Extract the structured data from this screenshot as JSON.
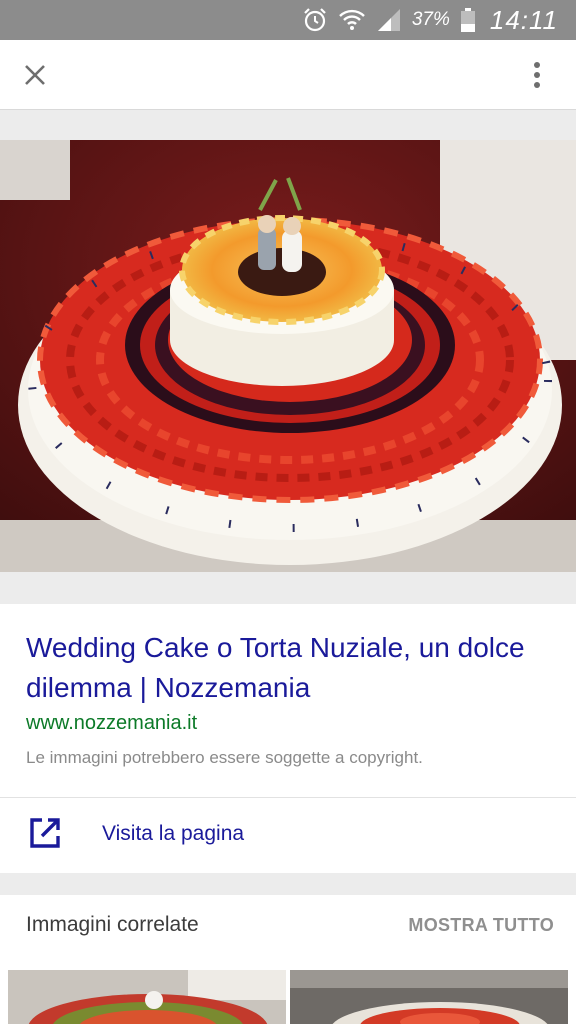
{
  "status_bar": {
    "battery_percent": "37%",
    "time": "14:11",
    "icons": [
      "alarm-icon",
      "wifi-icon",
      "signal-icon",
      "battery-icon"
    ]
  },
  "app_bar": {
    "icons": [
      "close-icon",
      "more-vert-icon"
    ]
  },
  "result": {
    "title": "Wedding Cake o Torta Nuziale, un dolce dilemma | Nozzemania",
    "site": "www.nozzemania.it",
    "copyright_notice": "Le immagini potrebbero essere soggette a copyright."
  },
  "visit": {
    "label": "Visita la pagina",
    "icon": "open-in-new-icon"
  },
  "related": {
    "title": "Immagini correlate",
    "show_all": "MOSTRA TUTTO"
  },
  "colors": {
    "link_blue": "#1a1a9a",
    "url_green": "#0c7a28",
    "status_bar": "#8c8c8c"
  }
}
